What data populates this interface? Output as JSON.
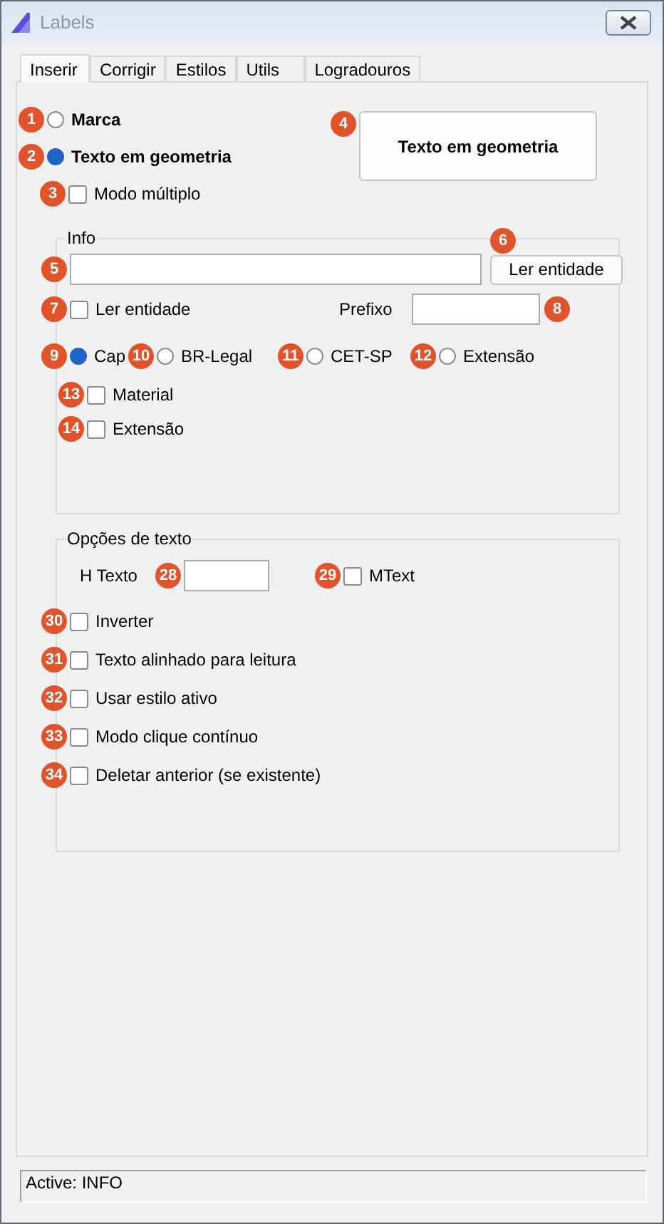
{
  "window": {
    "title": "Labels"
  },
  "tabs": [
    {
      "label": "Inserir",
      "selected": true
    },
    {
      "label": "Corrigir",
      "selected": false
    },
    {
      "label": "Estilos",
      "selected": false
    },
    {
      "label": "Utils",
      "selected": false
    },
    {
      "label": "Logradouros",
      "selected": false
    }
  ],
  "mode_options": [
    {
      "kind": "radio",
      "label": "Marca",
      "selected": false,
      "badge": "1"
    },
    {
      "kind": "radio",
      "label": "Texto em geometria",
      "selected": true,
      "badge": "2"
    },
    {
      "kind": "checkbox",
      "label": "Modo múltiplo",
      "checked": false,
      "badge": "3"
    }
  ],
  "preview_button": {
    "label": "Texto em geometria",
    "badge": "4"
  },
  "info": {
    "legend": "Info",
    "entity_field": {
      "badge": "5"
    },
    "read_button": {
      "label": "Ler entidade",
      "badge": "6"
    },
    "read_checkbox": {
      "label": "Ler entidade",
      "checked": false,
      "badge": "7"
    },
    "prefix": {
      "label": "Prefixo",
      "badge": "8"
    },
    "sources": [
      {
        "label": "Cap",
        "selected": true,
        "badge": "9"
      },
      {
        "label": "BR-Legal",
        "selected": false,
        "badge": "10"
      },
      {
        "label": "CET-SP",
        "selected": false,
        "badge": "11"
      },
      {
        "label": "Extensão",
        "selected": false,
        "badge": "12"
      }
    ],
    "extras": [
      {
        "label": "Material",
        "checked": false,
        "badge": "13"
      },
      {
        "label": "Extensão",
        "checked": false,
        "badge": "14"
      }
    ]
  },
  "text_options": {
    "legend": "Opções de texto",
    "height": {
      "label": "H Texto",
      "badge": "28"
    },
    "mtext": {
      "label": "MText",
      "checked": false,
      "badge": "29"
    },
    "checkboxes": [
      {
        "label": "Inverter",
        "checked": false,
        "badge": "30"
      },
      {
        "label": "Texto alinhado para leitura",
        "checked": false,
        "badge": "31"
      },
      {
        "label": "Usar estilo ativo",
        "checked": false,
        "badge": "32"
      },
      {
        "label": "Modo clique contínuo",
        "checked": false,
        "badge": "33"
      },
      {
        "label": "Deletar anterior (se existente)",
        "checked": false,
        "badge": "34"
      }
    ]
  },
  "status_bar": "Active: INFO"
}
